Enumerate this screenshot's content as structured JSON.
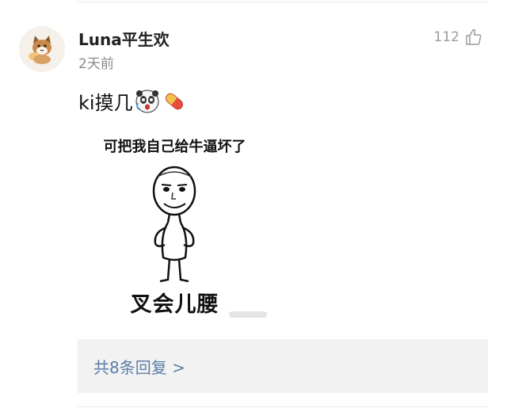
{
  "comment": {
    "username": "Luna平生欢",
    "time": "2天前",
    "likes": "112",
    "text": "ki摸几",
    "emojis": [
      "surprised-panda-emoji",
      "pill-emoji"
    ],
    "meme": {
      "top_text": "可把我自己给牛逼坏了",
      "bottom_text": "叉会儿腰"
    },
    "replies_label": "共8条回复 >"
  },
  "colors": {
    "link": "#5a7ea9",
    "secondary_text": "#8a8a8a",
    "reply_bg": "#f2f2f2"
  }
}
